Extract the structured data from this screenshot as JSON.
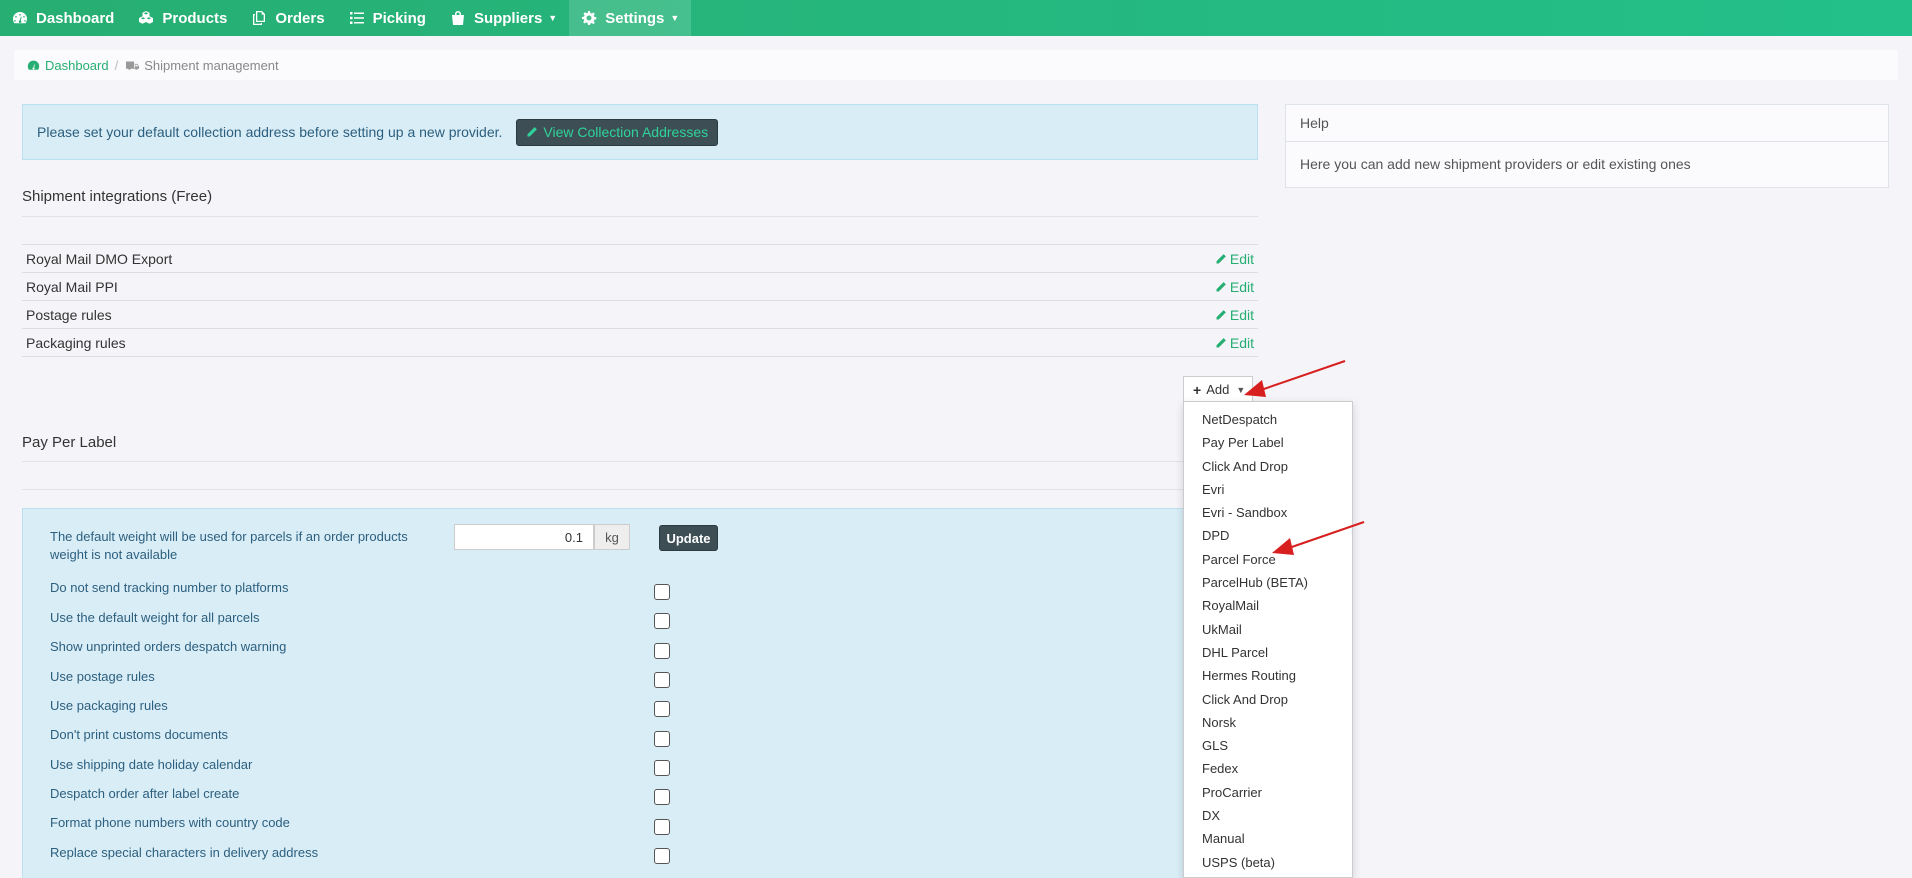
{
  "nav": {
    "items": [
      {
        "label": "Dashboard",
        "icon": "dashboard-icon"
      },
      {
        "label": "Products",
        "icon": "cubes-icon"
      },
      {
        "label": "Orders",
        "icon": "copy-icon"
      },
      {
        "label": "Picking",
        "icon": "list-icon"
      },
      {
        "label": "Suppliers",
        "icon": "shopping-bag-icon"
      },
      {
        "label": "Settings",
        "icon": "gear-icon"
      }
    ],
    "accent": "#27ae72"
  },
  "breadcrumb": {
    "home": "Dashboard",
    "current": "Shipment management"
  },
  "alert": {
    "text": "Please set your default collection address before setting up a new provider.",
    "button": "View Collection Addresses"
  },
  "help": {
    "title": "Help",
    "body": "Here you can add new shipment providers or edit existing ones"
  },
  "integrations": {
    "title": "Shipment integrations (Free)",
    "edit_label": "Edit",
    "rows": [
      {
        "name": "Royal Mail DMO Export"
      },
      {
        "name": "Royal Mail PPI"
      },
      {
        "name": "Postage rules"
      },
      {
        "name": "Packaging rules"
      }
    ]
  },
  "add": {
    "label": "Add",
    "options": [
      "NetDespatch",
      "Pay Per Label",
      "Click And Drop",
      "Evri",
      "Evri - Sandbox",
      "DPD",
      "Parcel Force",
      "ParcelHub (BETA)",
      "RoyalMail",
      "UkMail",
      "DHL Parcel",
      "Hermes Routing",
      "Click And Drop",
      "Norsk",
      "GLS",
      "Fedex",
      "ProCarrier",
      "DX",
      "Manual",
      "USPS (beta)"
    ]
  },
  "ppl": {
    "title": "Pay Per Label"
  },
  "settings": {
    "weight_label_1": "The default weight will be used for parcels if an order products",
    "weight_label_2": "weight is not available",
    "weight_value": "0.1",
    "weight_unit": "kg",
    "update_label": "Update",
    "options": [
      "Do not send tracking number to platforms",
      "Use the default weight for all parcels",
      "Show unprinted orders despatch warning",
      "Use postage rules",
      "Use packaging rules",
      "Don't print customs documents",
      "Use shipping date holiday calendar",
      "Despatch order after label create",
      "Format phone numbers with country code",
      "Replace special characters in delivery address"
    ]
  }
}
